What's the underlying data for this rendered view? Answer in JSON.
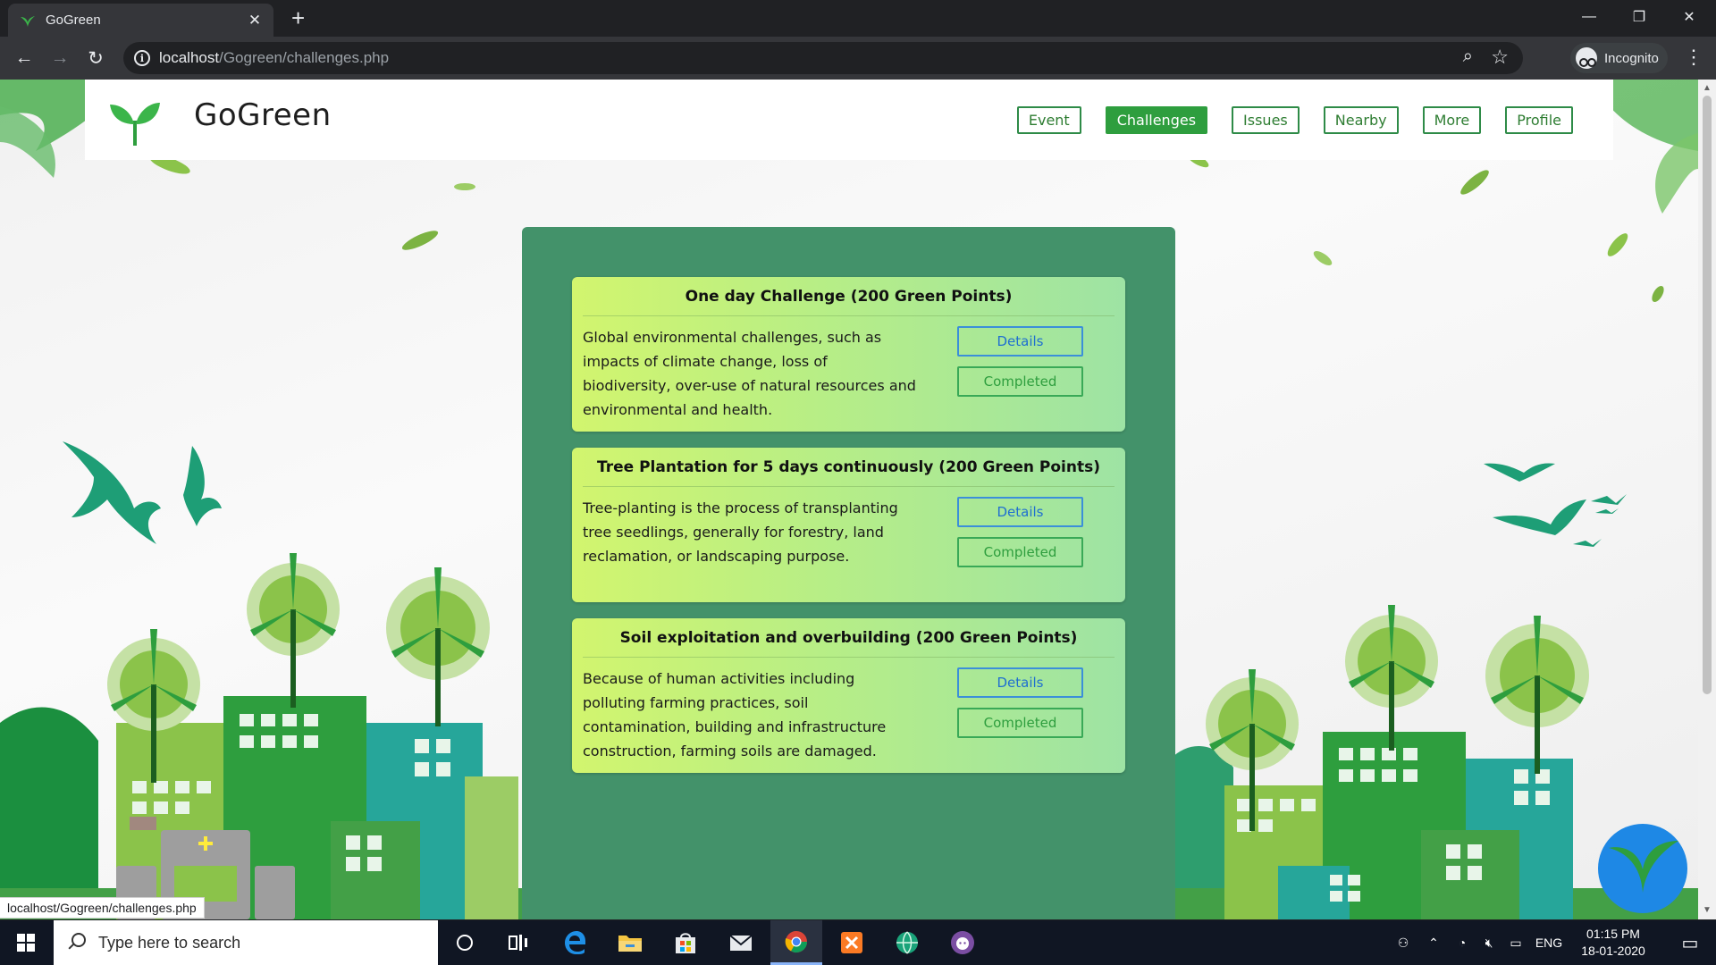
{
  "browser": {
    "tab_title": "GoGreen",
    "url_host": "localhost",
    "url_path": "/Gogreen/challenges.php",
    "incognito_label": "Incognito",
    "status_url": "localhost/Gogreen/challenges.php"
  },
  "site": {
    "brand": "GoGreen",
    "nav": [
      {
        "label": "Event",
        "active": false
      },
      {
        "label": "Challenges",
        "active": true
      },
      {
        "label": "Issues",
        "active": false
      },
      {
        "label": "Nearby",
        "active": false
      },
      {
        "label": "More",
        "active": false
      },
      {
        "label": "Profile",
        "active": false
      }
    ]
  },
  "challenges": [
    {
      "title": "One day Challenge (200 Green Points)",
      "description": "Global environmental challenges, such as impacts of climate change, loss of biodiversity, over-use of natural resources and environmental and health.",
      "details_label": "Details",
      "status_label": "Completed"
    },
    {
      "title": "Tree Plantation for 5 days continuously (200 Green Points)",
      "description": "Tree-planting is the process of transplanting tree seedlings, generally for forestry, land reclamation, or landscaping purpose.",
      "details_label": "Details",
      "status_label": "Completed"
    },
    {
      "title": "Soil exploitation and overbuilding (200 Green Points)",
      "description": "Because of human activities including polluting farming practices, soil contamination, building and infrastructure construction, farming soils are damaged.",
      "details_label": "Details",
      "status_label": "Completed"
    }
  ],
  "taskbar": {
    "search_placeholder": "Type here to search",
    "language": "ENG",
    "time": "01:15 PM",
    "date": "18-01-2020"
  },
  "colors": {
    "panel": "#43926a",
    "accent_green": "#2e9e3e",
    "details_blue": "#1f6fd0"
  }
}
